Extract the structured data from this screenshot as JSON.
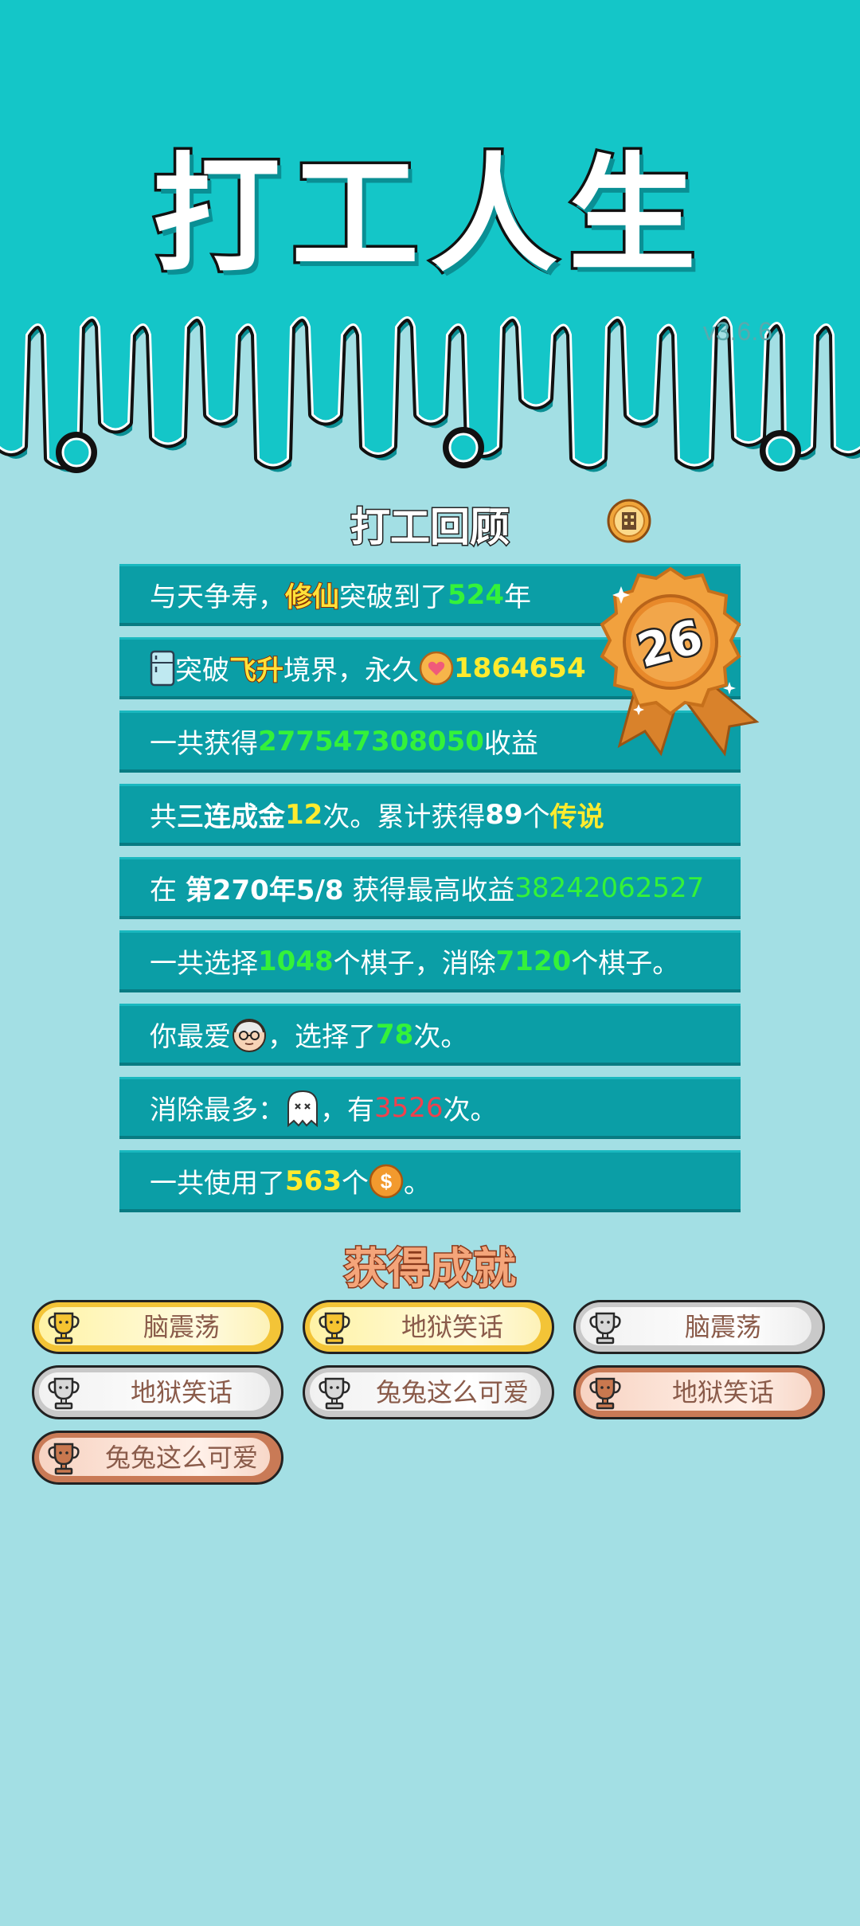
{
  "header": {
    "title": "打工人生",
    "version": "v3.6.6"
  },
  "review": {
    "title": "打工回顾",
    "medal_level": "26"
  },
  "stats": {
    "row1": {
      "a": "与天争寿，",
      "b": "修仙",
      "c": "突破到了",
      "d": "524",
      "e": "年"
    },
    "row2": {
      "a": "突破",
      "b": "飞升",
      "c": "境界，永久",
      "d": "1864654"
    },
    "row3": {
      "a": "一共获得",
      "b": "277547308050",
      "c": "收益"
    },
    "row4": {
      "a": "共",
      "b": "三连成金",
      "c": "12",
      "d": "次。累计获得",
      "e": "89",
      "f": "个",
      "g": "传说"
    },
    "row5": {
      "a": "在 ",
      "b": "第270年5/8",
      "c": " 获得最高收益",
      "d": "38242062527"
    },
    "row6": {
      "a": "一共选择",
      "b": "1048",
      "c": "个棋子，消除",
      "d": "7120",
      "e": "个棋子。"
    },
    "row7": {
      "a": "你最爱",
      "b": "，选择了",
      "c": "78",
      "d": "次。"
    },
    "row8": {
      "a": "消除最多：",
      "b": "，有",
      "c": "3526",
      "d": "次。"
    },
    "row9": {
      "a": "一共使用了",
      "b": "563",
      "c": "个",
      "d": "。"
    }
  },
  "achievements": {
    "title": "获得成就",
    "items": [
      {
        "label": "脑震荡",
        "tier": "gold"
      },
      {
        "label": "地狱笑话",
        "tier": "gold"
      },
      {
        "label": "脑震荡",
        "tier": "silver"
      },
      {
        "label": "地狱笑话",
        "tier": "silver"
      },
      {
        "label": "兔兔这么可爱",
        "tier": "silver"
      },
      {
        "label": "地狱笑话",
        "tier": "bronze"
      },
      {
        "label": "兔兔这么可爱",
        "tier": "bronze"
      }
    ]
  },
  "colors": {
    "top_bg": "#14c6c8",
    "page_bg": "#a3dfe4",
    "row_bg": "#0b9ea6",
    "value_green": "#34f23a",
    "value_yellow": "#ffeb2e",
    "value_red": "#f0414d"
  },
  "icons": {
    "fridge": "fridge-icon",
    "heart_coin": "heart-coin-icon",
    "old_man": "old-man-face-icon",
    "ghost": "ghost-icon",
    "dollar_coin": "dollar-coin-icon",
    "trophy": "trophy-icon",
    "medal": "medal-ribbon-icon"
  }
}
